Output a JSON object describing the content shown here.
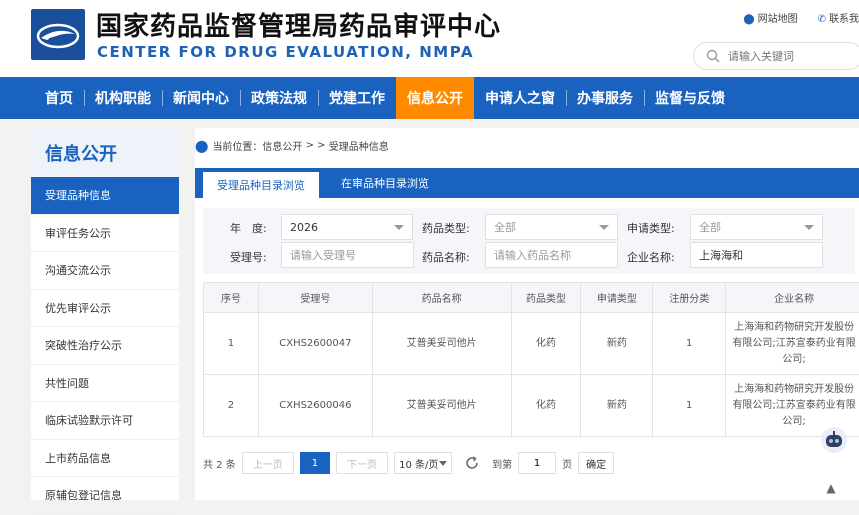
{
  "header": {
    "title_cn": "国家药品监督管理局药品审评中心",
    "title_en": "CENTER FOR DRUG EVALUATION, NMPA",
    "site_map": "网站地图",
    "contact": "联系我",
    "search_placeholder": "请输入关键词"
  },
  "nav": [
    "首页",
    "机构职能",
    "新闻中心",
    "政策法规",
    "党建工作",
    "信息公开",
    "申请人之窗",
    "办事服务",
    "监督与反馈"
  ],
  "sidebar": {
    "title": "信息公开",
    "items": [
      "受理品种信息",
      "审评任务公示",
      "沟通交流公示",
      "优先审评公示",
      "突破性治疗公示",
      "共性问题",
      "临床试验默示许可",
      "上市药品信息",
      "原辅包登记信息"
    ]
  },
  "breadcrumb": {
    "label": "当前位置：信息公开",
    "sep": "> >",
    "current": "受理品种信息"
  },
  "tabs": [
    "受理品种目录浏览",
    "在审品种目录浏览"
  ],
  "filters": {
    "year_label": "年　度:",
    "year_value": "2026",
    "drug_type_label": "药品类型:",
    "drug_type_value": "全部",
    "apply_type_label": "申请类型:",
    "apply_type_value": "全部",
    "accept_no_label": "受理号:",
    "accept_no_placeholder": "请输入受理号",
    "drug_name_label": "药品名称:",
    "drug_name_placeholder": "请输入药品名称",
    "company_label": "企业名称:",
    "company_value": "上海海和"
  },
  "table": {
    "headers": [
      "序号",
      "受理号",
      "药品名称",
      "药品类型",
      "申请类型",
      "注册分类",
      "企业名称"
    ],
    "rows": [
      [
        "1",
        "CXHS2600047",
        "艾普美妥司他片",
        "化药",
        "新药",
        "1",
        "上海海和药物研究开发股份有限公司;江苏宣泰药业有限公司;"
      ],
      [
        "2",
        "CXHS2600046",
        "艾普美妥司他片",
        "化药",
        "新药",
        "1",
        "上海海和药物研究开发股份有限公司;江苏宣泰药业有限公司;"
      ]
    ]
  },
  "pager": {
    "total": "共 2 条",
    "prev": "上一页",
    "current": "1",
    "next": "下一页",
    "page_size": "10 条/页",
    "goto": "到第",
    "goto_value": "1",
    "page_unit": "页",
    "confirm": "确定"
  },
  "colors": {
    "brand_blue": "#1a62c0",
    "active_orange": "#ff8a00"
  }
}
